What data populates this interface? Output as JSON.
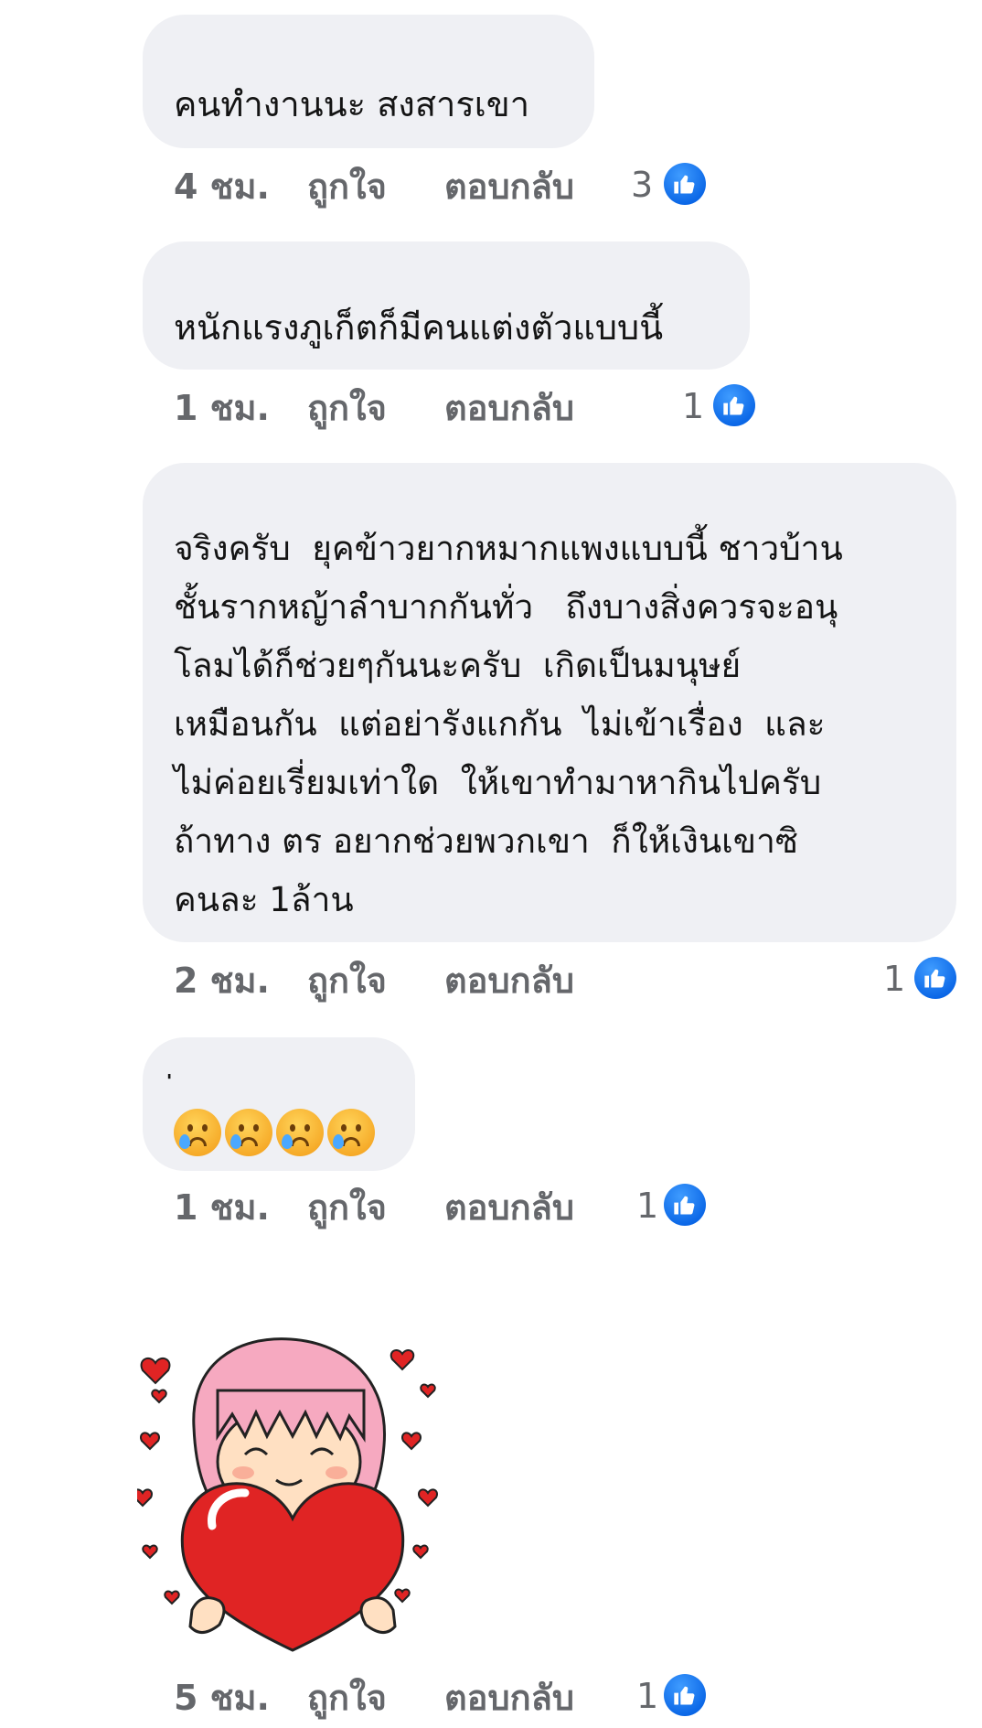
{
  "comments": [
    {
      "text": "คนทำงานนะ สงสารเขา",
      "time": "4 ชม.",
      "like_label": "ถูกใจ",
      "reply_label": "ตอบกลับ",
      "reaction_count": "3",
      "reaction_icon": "thumbs-up-icon"
    },
    {
      "text": "หนักแรงภูเก็ตก็มีคนแต่งตัวแบบนี้",
      "time": "1 ชม.",
      "like_label": "ถูกใจ",
      "reply_label": "ตอบกลับ",
      "reaction_count": "1",
      "reaction_icon": "thumbs-up-icon"
    },
    {
      "text": "จริงครับ  ยุคข้าวยากหมากแพงแบบนี้ ชาวบ้าน\nชั้นรากหญ้าลำบากกันทั่ว   ถึงบางสิ่งควรจะอนุ\nโลมได้ก็ช่วยๆกันนะครับ  เกิดเป็นมนุษย์\nเหมือนกัน  แต่อย่ารังแกกัน  ไม่เข้าเรื่อง  และ\nไม่ค่อยเรี่ยมเท่าใด  ให้เขาทำมาหากินไปครับ\nถ้าทาง ตร อยากช่วยพวกเขา  ก็ให้เงินเขาซิ\nคนละ 1ล้าน",
      "time": "2 ชม.",
      "like_label": "ถูกใจ",
      "reply_label": "ตอบกลับ",
      "reaction_count": "1",
      "reaction_icon": "thumbs-up-icon"
    },
    {
      "text": "่",
      "emoji": [
        "crying-face-icon",
        "crying-face-icon",
        "crying-face-icon",
        "crying-face-icon"
      ],
      "time": "1 ชม.",
      "like_label": "ถูกใจ",
      "reply_label": "ตอบกลับ",
      "reaction_count": "1",
      "reaction_icon": "thumbs-up-icon"
    },
    {
      "sticker": "girl-hugging-heart-sticker",
      "time": "5 ชม.",
      "like_label": "ถูกใจ",
      "reply_label": "ตอบกลับ",
      "reaction_count": "1",
      "reaction_icon": "thumbs-up-icon"
    }
  ],
  "colors": {
    "bubble": "#eff0f4",
    "meta_text": "#65676b",
    "like_blue": "#0a66e6"
  }
}
